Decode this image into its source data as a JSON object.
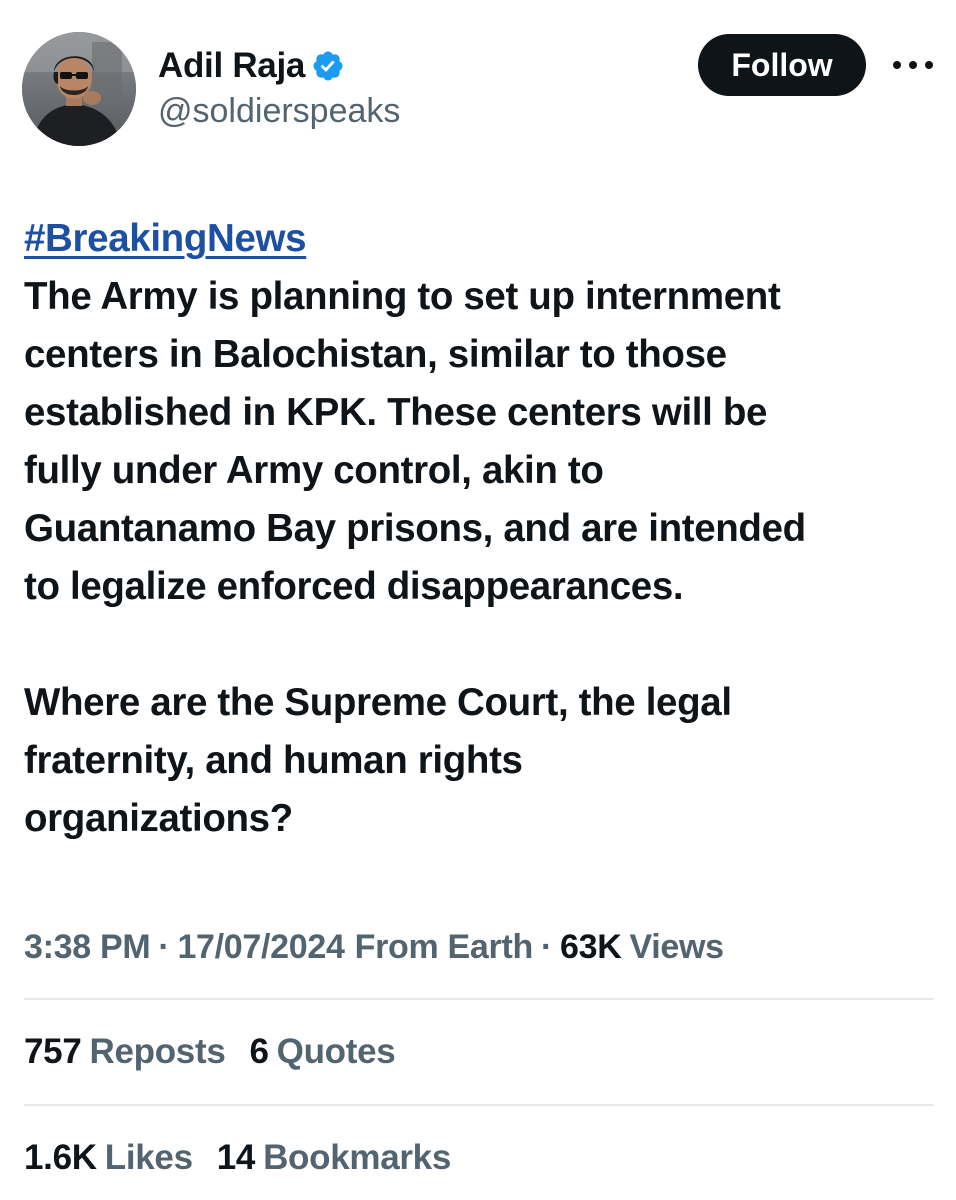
{
  "author": {
    "name": "Adil Raja",
    "handle": "@soldierspeaks",
    "verified_icon": "verified-badge-icon",
    "avatar_icon": "profile-photo"
  },
  "actions": {
    "follow_label": "Follow",
    "more_icon": "more-horizontal-icon"
  },
  "tweet": {
    "hashtag": "#BreakingNews",
    "paragraph_1": "The Army is planning to set up internment\ncenters in Balochistan, similar to those\nestablished in KPK. These centers will be\nfully under Army control, akin to\nGuantanamo Bay prisons, and are intended\nto legalize enforced disappearances.",
    "paragraph_2": "Where are the Supreme Court, the legal\nfraternity, and human rights\norganizations?"
  },
  "meta": {
    "time": "3:38 PM",
    "separator": "·",
    "date": "17/07/2024",
    "source": "From Earth",
    "views_count": "63K",
    "views_label": "Views"
  },
  "stats": {
    "reposts_count": "757",
    "reposts_label": "Reposts",
    "quotes_count": "6",
    "quotes_label": "Quotes",
    "likes_count": "1.6K",
    "likes_label": "Likes",
    "bookmarks_count": "14",
    "bookmarks_label": "Bookmarks"
  },
  "colors": {
    "text_primary": "#0f1419",
    "text_secondary": "#536471",
    "link": "#1d4fa3",
    "verified": "#1d9bf0",
    "divider": "#e4e8ea",
    "button_bg": "#0f1419"
  }
}
